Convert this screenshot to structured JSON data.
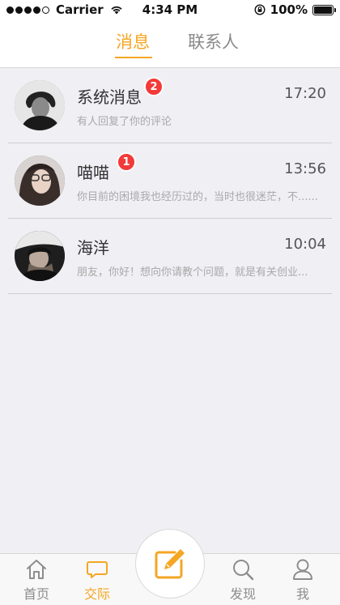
{
  "status_bar": {
    "carrier": "Carrier",
    "time": "4:34 PM",
    "battery": "100%",
    "signal_icon": "signal-dots-icon",
    "wifi_icon": "wifi-icon",
    "lock_icon": "rotation-lock-icon",
    "battery_icon": "battery-icon"
  },
  "top_tabs": [
    {
      "label": "消息",
      "active": true
    },
    {
      "label": "联系人",
      "active": false
    }
  ],
  "messages": [
    {
      "name": "系统消息",
      "badge": "2",
      "time": "17:20",
      "preview": "有人回复了你的评论"
    },
    {
      "name": "喵喵",
      "badge": "1",
      "time": "13:56",
      "preview": "你目前的困境我也经历过的，当时也很迷茫，不......"
    },
    {
      "name": "海洋",
      "badge": "",
      "time": "10:04",
      "preview": "朋友，你好！想向你请教个问题，就是有关创业..."
    }
  ],
  "tab_bar": {
    "home": "首页",
    "social": "交际",
    "discover": "发现",
    "me": "我",
    "compose_icon": "compose-edit-icon"
  },
  "colors": {
    "accent": "#f5a623",
    "badge": "#f23a3a",
    "background": "#efeff4"
  }
}
